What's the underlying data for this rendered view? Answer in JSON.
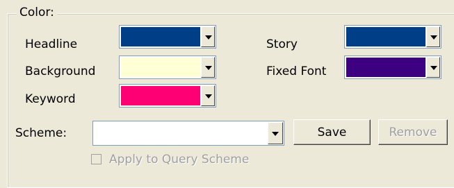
{
  "group": {
    "title": "Color:"
  },
  "colors": {
    "headline": {
      "label": "Headline",
      "color": "#003f87"
    },
    "story": {
      "label": "Story",
      "color": "#003f87"
    },
    "background": {
      "label": "Background",
      "color": "#ffffd6"
    },
    "fixed_font": {
      "label": "Fixed Font",
      "color": "#3d0080"
    },
    "keyword": {
      "label": "Keyword",
      "color": "#ff0074"
    }
  },
  "scheme": {
    "label": "Scheme:",
    "value": ""
  },
  "buttons": {
    "save": "Save",
    "remove": "Remove"
  },
  "apply_query": {
    "label": "Apply to Query Scheme",
    "checked": false,
    "enabled": false
  }
}
